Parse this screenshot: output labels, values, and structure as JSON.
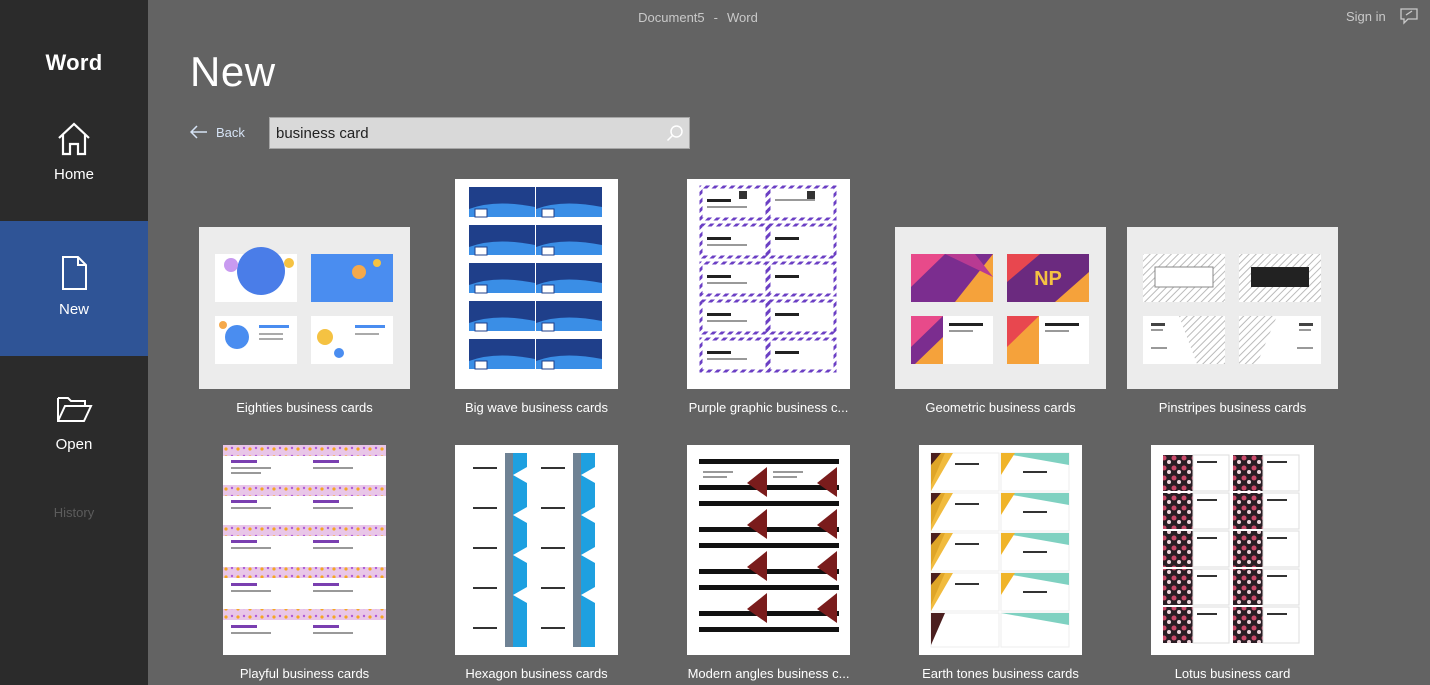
{
  "app": {
    "name": "Word",
    "window_title": "Document5",
    "window_app": "Word",
    "title_separator": "-",
    "sign_in": "Sign in"
  },
  "sidebar": {
    "items": [
      {
        "label": "Home",
        "icon": "home-icon",
        "active": false
      },
      {
        "label": "New",
        "icon": "new-document-icon",
        "active": true
      },
      {
        "label": "Open",
        "icon": "folder-open-icon",
        "active": false
      }
    ],
    "history": "History"
  },
  "main": {
    "title": "New",
    "back_label": "Back",
    "search": {
      "value": "business card"
    }
  },
  "templates": [
    {
      "label": "Eighties business cards"
    },
    {
      "label": "Big wave business cards"
    },
    {
      "label": "Purple graphic business c..."
    },
    {
      "label": "Geometric business cards"
    },
    {
      "label": "Pinstripes business cards"
    },
    {
      "label": "Playful business cards"
    },
    {
      "label": "Hexagon business cards"
    },
    {
      "label": "Modern angles business c..."
    },
    {
      "label": "Earth tones business cards"
    },
    {
      "label": "Lotus business card"
    }
  ],
  "colors": {
    "sidebar_bg": "#2b2b2b",
    "sidebar_active": "#2f5496",
    "main_bg": "#636363"
  }
}
